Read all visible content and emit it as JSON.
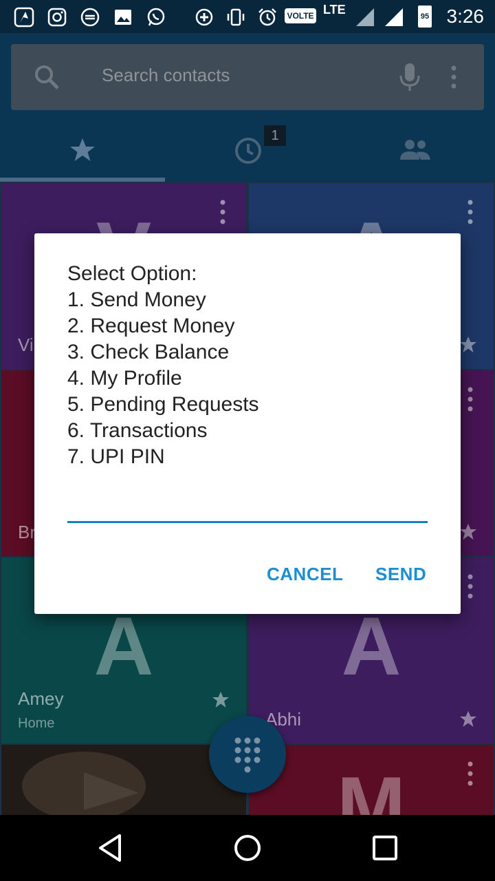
{
  "status_bar": {
    "time": "3:26",
    "volte_label": "VOLTE",
    "network": "LTE",
    "battery": "95",
    "icons": [
      "app-icon",
      "instagram-icon",
      "sync-icon",
      "image-icon",
      "whatsapp-icon",
      "data-saver-icon",
      "vibrate-icon",
      "alarm-icon",
      "signal-icon",
      "signal-icon"
    ]
  },
  "search": {
    "placeholder": "Search contacts"
  },
  "tabs": {
    "items": [
      {
        "name": "favorites",
        "icon": "star-icon"
      },
      {
        "name": "recents",
        "icon": "clock-icon",
        "badge": "1"
      },
      {
        "name": "contacts",
        "icon": "people-icon"
      }
    ]
  },
  "tiles": [
    {
      "letter": "V",
      "name": "Vi",
      "color": "#5b2a8c"
    },
    {
      "letter": "A",
      "name": "",
      "color": "#2b4f9a"
    },
    {
      "letter": "",
      "name": "Br",
      "color": "#8b1538"
    },
    {
      "letter": "",
      "name": "",
      "color": "#6a1f78"
    },
    {
      "letter": "A",
      "name": "Amey",
      "sub": "Home",
      "color": "#0f6b6d"
    },
    {
      "letter": "A",
      "name": "Abhi",
      "color": "#5b2a8c"
    },
    {
      "letter": "",
      "name": "",
      "color": "#2f2a24"
    },
    {
      "letter": "M",
      "name": "",
      "color": "#8b1538"
    }
  ],
  "dialog": {
    "text": "Select Option:\n1. Send Money\n2. Request Money\n3. Check Balance\n4. My Profile\n5. Pending Requests\n6. Transactions\n7. UPI PIN",
    "input_value": "",
    "cancel_label": "CANCEL",
    "send_label": "SEND"
  }
}
